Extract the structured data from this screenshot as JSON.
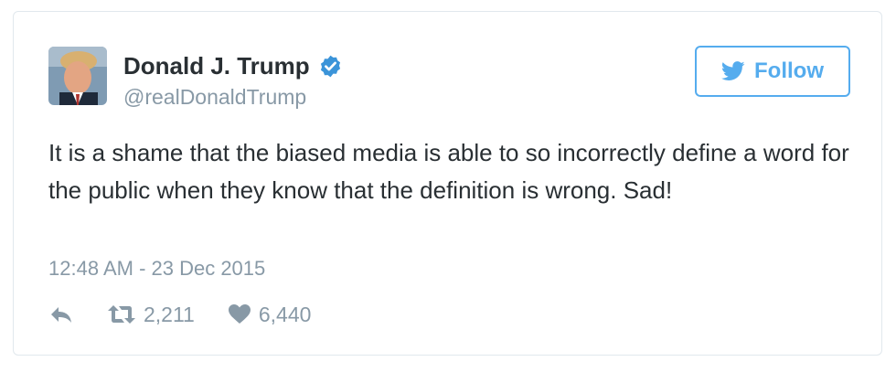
{
  "tweet": {
    "author_name": "Donald J. Trump",
    "handle": "@realDonaldTrump",
    "verified": true,
    "text": "It is a shame that the biased media is able to so incorrectly define a word for the public when they know that the definition is wrong. Sad!",
    "timestamp": "12:48 AM - 23 Dec 2015",
    "follow_label": "Follow",
    "retweet_count": "2,211",
    "like_count": "6,440"
  },
  "icons": {
    "verified": "verified-badge-icon",
    "follow": "twitter-bird-icon",
    "reply": "reply-icon",
    "retweet": "retweet-icon",
    "like": "heart-icon"
  },
  "colors": {
    "accent": "#55acee",
    "verified": "#3b94d9",
    "text": "#292f33",
    "muted": "#8899a6",
    "border": "#e1e8ed"
  }
}
